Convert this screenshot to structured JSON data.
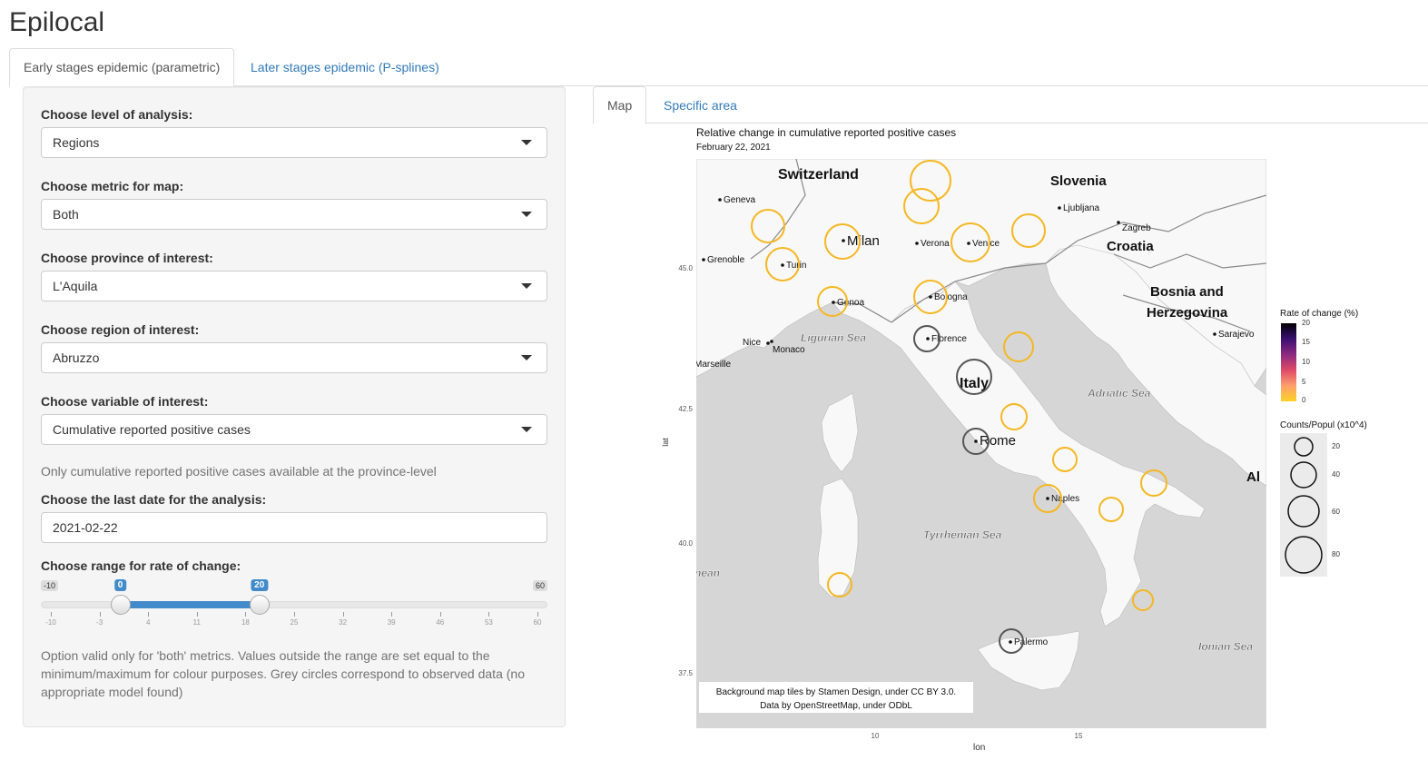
{
  "app": {
    "title": "Epilocal"
  },
  "tabs": [
    {
      "label": "Early stages epidemic (parametric)"
    },
    {
      "label": "Later stages epidemic (P-splines)"
    }
  ],
  "sidebar": {
    "level": {
      "label": "Choose level of analysis:",
      "value": "Regions"
    },
    "metric": {
      "label": "Choose metric for map:",
      "value": "Both"
    },
    "province": {
      "label": "Choose province of interest:",
      "value": "L'Aquila"
    },
    "region": {
      "label": "Choose region of interest:",
      "value": "Abruzzo"
    },
    "variable": {
      "label": "Choose variable of interest:",
      "value": "Cumulative reported positive cases"
    },
    "variable_help": "Only cumulative reported positive cases available at the province-level",
    "date": {
      "label": "Choose the last date for the analysis:",
      "value": "2021-02-22"
    },
    "range": {
      "label": "Choose range for rate of change:",
      "min": "-10",
      "max": "60",
      "from": 0,
      "to": 20,
      "from_label": "0",
      "to_label": "20",
      "ticks": [
        "-10",
        "-3",
        "4",
        "11",
        "18",
        "25",
        "32",
        "39",
        "46",
        "53",
        "60"
      ]
    },
    "range_help": "Option valid only for 'both' metrics. Values outside the range are set equal to the minimum/maximum for colour purposes. Grey circles correspond to observed data (no appropriate model found)"
  },
  "main_tabs": [
    {
      "label": "Map"
    },
    {
      "label": "Specific area"
    }
  ],
  "map": {
    "title": "Relative change in cumulative reported positive cases",
    "subtitle": "February 22, 2021",
    "xlabel": "lon",
    "ylabel": "lat",
    "x_ticks": [
      "10",
      "15"
    ],
    "y_ticks": [
      "45.0",
      "42.5",
      "40.0",
      "37.5"
    ],
    "attribution_line1": "Background map tiles by Stamen Design, under CC BY 3.0.",
    "attribution_line2": "Data by OpenStreetMap, under ODbL",
    "countries": [
      "Switzerland",
      "Slovenia",
      "Croatia",
      "Bosnia and",
      "Herzegovina",
      "Italy",
      "Al"
    ],
    "cities": [
      "Geneva",
      "Grenoble",
      "Milan",
      "Turin",
      "Genoa",
      "Verona",
      "Venice",
      "Ljubljana",
      "Zagreb",
      "Bologna",
      "Florence",
      "Nice",
      "Monaco",
      "Marseille",
      "Rome",
      "Naples",
      "Palermo",
      "Sarajevo"
    ],
    "seas": [
      "Ligurian Sea",
      "Adriatic Sea",
      "Tyrrhenian Sea",
      "Ionian Sea",
      "nean"
    ],
    "circle_colors": {
      "model": "#f5b722",
      "observed": "#555555"
    }
  },
  "legend": {
    "color_title": "Rate of change (%)",
    "color_ticks": [
      "20",
      "15",
      "10",
      "5",
      "0"
    ],
    "size_title": "Counts/Popul (x10^4)",
    "size_ticks": [
      "20",
      "40",
      "60",
      "80"
    ]
  }
}
